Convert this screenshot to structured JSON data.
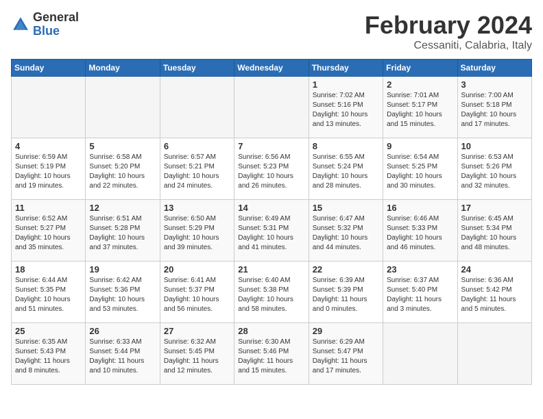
{
  "logo": {
    "general": "General",
    "blue": "Blue"
  },
  "header": {
    "month": "February 2024",
    "location": "Cessaniti, Calabria, Italy"
  },
  "weekdays": [
    "Sunday",
    "Monday",
    "Tuesday",
    "Wednesday",
    "Thursday",
    "Friday",
    "Saturday"
  ],
  "weeks": [
    [
      {
        "day": "",
        "info": ""
      },
      {
        "day": "",
        "info": ""
      },
      {
        "day": "",
        "info": ""
      },
      {
        "day": "",
        "info": ""
      },
      {
        "day": "1",
        "info": "Sunrise: 7:02 AM\nSunset: 5:16 PM\nDaylight: 10 hours\nand 13 minutes."
      },
      {
        "day": "2",
        "info": "Sunrise: 7:01 AM\nSunset: 5:17 PM\nDaylight: 10 hours\nand 15 minutes."
      },
      {
        "day": "3",
        "info": "Sunrise: 7:00 AM\nSunset: 5:18 PM\nDaylight: 10 hours\nand 17 minutes."
      }
    ],
    [
      {
        "day": "4",
        "info": "Sunrise: 6:59 AM\nSunset: 5:19 PM\nDaylight: 10 hours\nand 19 minutes."
      },
      {
        "day": "5",
        "info": "Sunrise: 6:58 AM\nSunset: 5:20 PM\nDaylight: 10 hours\nand 22 minutes."
      },
      {
        "day": "6",
        "info": "Sunrise: 6:57 AM\nSunset: 5:21 PM\nDaylight: 10 hours\nand 24 minutes."
      },
      {
        "day": "7",
        "info": "Sunrise: 6:56 AM\nSunset: 5:23 PM\nDaylight: 10 hours\nand 26 minutes."
      },
      {
        "day": "8",
        "info": "Sunrise: 6:55 AM\nSunset: 5:24 PM\nDaylight: 10 hours\nand 28 minutes."
      },
      {
        "day": "9",
        "info": "Sunrise: 6:54 AM\nSunset: 5:25 PM\nDaylight: 10 hours\nand 30 minutes."
      },
      {
        "day": "10",
        "info": "Sunrise: 6:53 AM\nSunset: 5:26 PM\nDaylight: 10 hours\nand 32 minutes."
      }
    ],
    [
      {
        "day": "11",
        "info": "Sunrise: 6:52 AM\nSunset: 5:27 PM\nDaylight: 10 hours\nand 35 minutes."
      },
      {
        "day": "12",
        "info": "Sunrise: 6:51 AM\nSunset: 5:28 PM\nDaylight: 10 hours\nand 37 minutes."
      },
      {
        "day": "13",
        "info": "Sunrise: 6:50 AM\nSunset: 5:29 PM\nDaylight: 10 hours\nand 39 minutes."
      },
      {
        "day": "14",
        "info": "Sunrise: 6:49 AM\nSunset: 5:31 PM\nDaylight: 10 hours\nand 41 minutes."
      },
      {
        "day": "15",
        "info": "Sunrise: 6:47 AM\nSunset: 5:32 PM\nDaylight: 10 hours\nand 44 minutes."
      },
      {
        "day": "16",
        "info": "Sunrise: 6:46 AM\nSunset: 5:33 PM\nDaylight: 10 hours\nand 46 minutes."
      },
      {
        "day": "17",
        "info": "Sunrise: 6:45 AM\nSunset: 5:34 PM\nDaylight: 10 hours\nand 48 minutes."
      }
    ],
    [
      {
        "day": "18",
        "info": "Sunrise: 6:44 AM\nSunset: 5:35 PM\nDaylight: 10 hours\nand 51 minutes."
      },
      {
        "day": "19",
        "info": "Sunrise: 6:42 AM\nSunset: 5:36 PM\nDaylight: 10 hours\nand 53 minutes."
      },
      {
        "day": "20",
        "info": "Sunrise: 6:41 AM\nSunset: 5:37 PM\nDaylight: 10 hours\nand 56 minutes."
      },
      {
        "day": "21",
        "info": "Sunrise: 6:40 AM\nSunset: 5:38 PM\nDaylight: 10 hours\nand 58 minutes."
      },
      {
        "day": "22",
        "info": "Sunrise: 6:39 AM\nSunset: 5:39 PM\nDaylight: 11 hours\nand 0 minutes."
      },
      {
        "day": "23",
        "info": "Sunrise: 6:37 AM\nSunset: 5:40 PM\nDaylight: 11 hours\nand 3 minutes."
      },
      {
        "day": "24",
        "info": "Sunrise: 6:36 AM\nSunset: 5:42 PM\nDaylight: 11 hours\nand 5 minutes."
      }
    ],
    [
      {
        "day": "25",
        "info": "Sunrise: 6:35 AM\nSunset: 5:43 PM\nDaylight: 11 hours\nand 8 minutes."
      },
      {
        "day": "26",
        "info": "Sunrise: 6:33 AM\nSunset: 5:44 PM\nDaylight: 11 hours\nand 10 minutes."
      },
      {
        "day": "27",
        "info": "Sunrise: 6:32 AM\nSunset: 5:45 PM\nDaylight: 11 hours\nand 12 minutes."
      },
      {
        "day": "28",
        "info": "Sunrise: 6:30 AM\nSunset: 5:46 PM\nDaylight: 11 hours\nand 15 minutes."
      },
      {
        "day": "29",
        "info": "Sunrise: 6:29 AM\nSunset: 5:47 PM\nDaylight: 11 hours\nand 17 minutes."
      },
      {
        "day": "",
        "info": ""
      },
      {
        "day": "",
        "info": ""
      }
    ]
  ]
}
